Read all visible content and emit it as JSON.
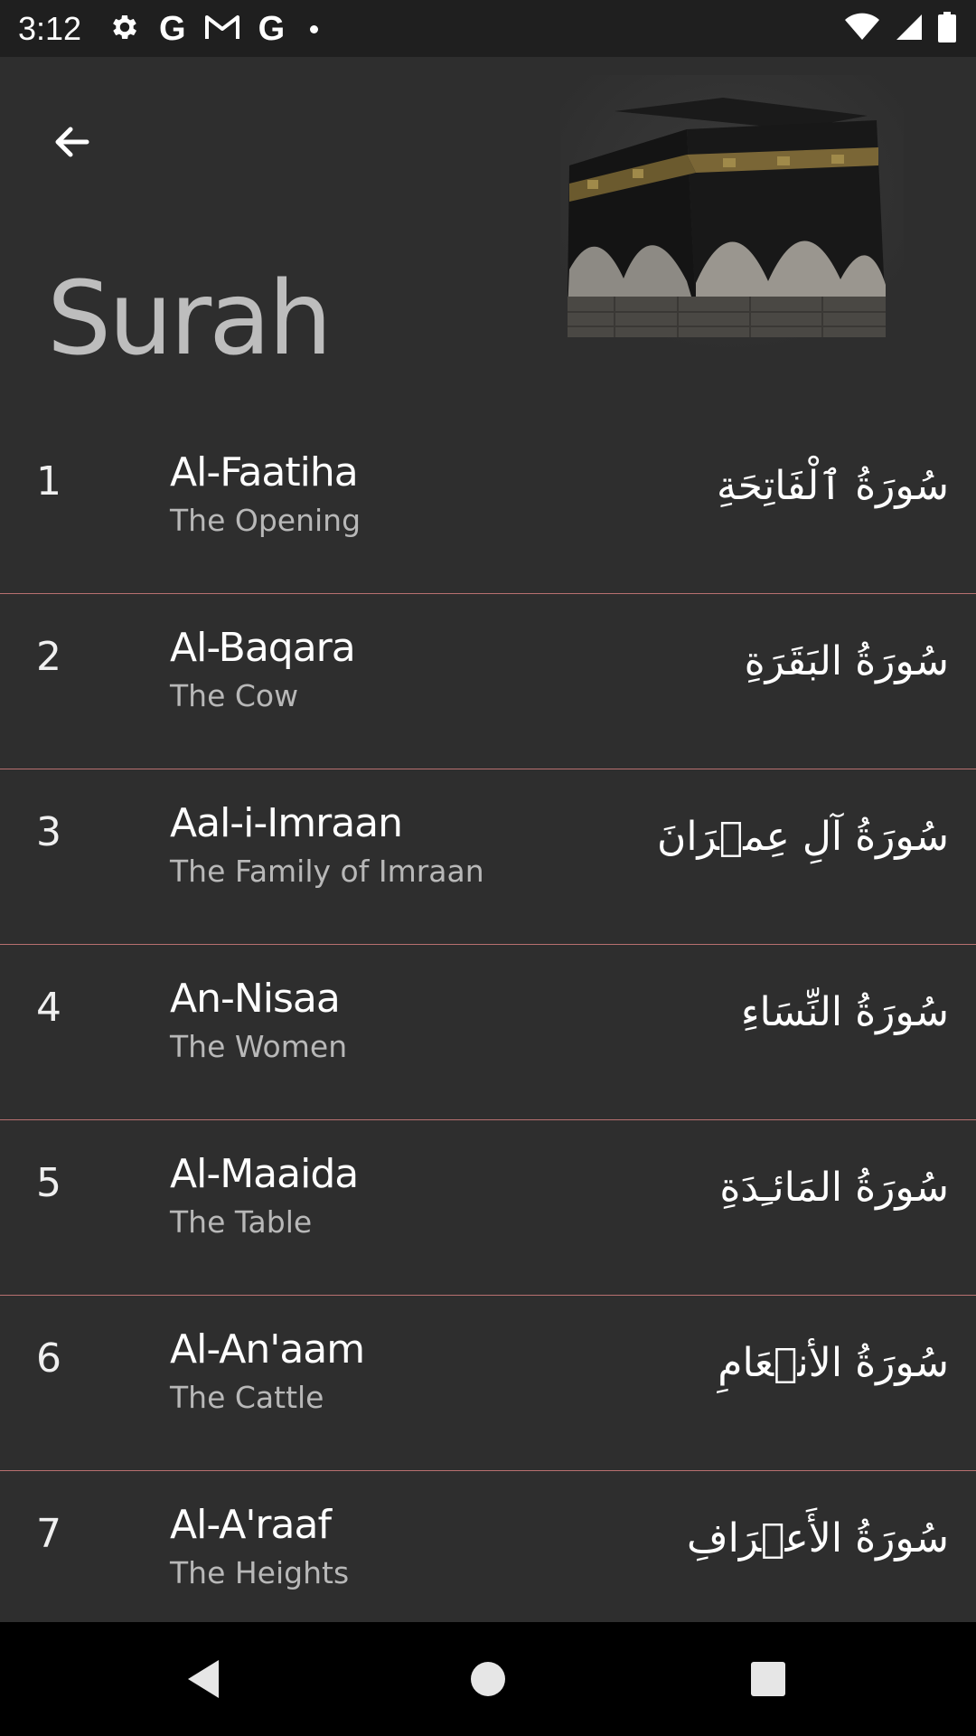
{
  "status_bar": {
    "time": "3:12",
    "left_icons": [
      "gear-icon",
      "google-icon",
      "gmail-icon",
      "google-icon",
      "dot-icon"
    ],
    "right_icons": [
      "wifi-icon",
      "signal-icon",
      "battery-icon"
    ],
    "left_glyphs": {
      "google": "G"
    }
  },
  "header": {
    "title": "Surah",
    "back_icon": "arrow-back-icon",
    "image": "kaaba-image"
  },
  "surahs": [
    {
      "number": "1",
      "name": "Al-Faatiha",
      "meaning": "The Opening",
      "arabic": "سُورَةُ ٱلْفَاتِحَةِ"
    },
    {
      "number": "2",
      "name": "Al-Baqara",
      "meaning": "The Cow",
      "arabic": "سُورَةُ البَقَرَةِ"
    },
    {
      "number": "3",
      "name": "Aal-i-Imraan",
      "meaning": "The Family of Imraan",
      "arabic": "سُورَةُ آلِ عِمۡرَانَ"
    },
    {
      "number": "4",
      "name": "An-Nisaa",
      "meaning": "The Women",
      "arabic": "سُورَةُ النِّسَاءِ"
    },
    {
      "number": "5",
      "name": "Al-Maaida",
      "meaning": "The Table",
      "arabic": "سُورَةُ المَائـِدَةِ"
    },
    {
      "number": "6",
      "name": "Al-An'aam",
      "meaning": "The Cattle",
      "arabic": "سُورَةُ الأنۡعَامِ"
    },
    {
      "number": "7",
      "name": "Al-A'raaf",
      "meaning": "The Heights",
      "arabic": "سُورَةُ الأَعۡرَافِ"
    }
  ],
  "nav_bar": {
    "buttons": [
      "back-triangle-icon",
      "home-circle-icon",
      "recents-square-icon"
    ]
  },
  "colors": {
    "background": "#2e2e2e",
    "status_bar": "#1f1f1f",
    "divider": "#b87070",
    "title": "#bdbdbd",
    "meaning": "#b8b8b8",
    "nav_bar": "#000000"
  }
}
